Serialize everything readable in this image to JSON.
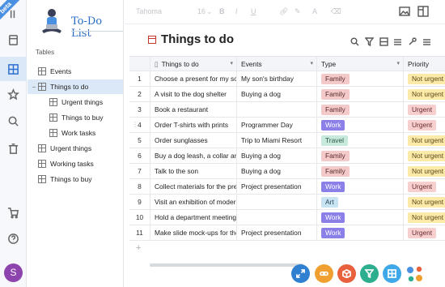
{
  "badge": "beta",
  "app": {
    "title": "To-Do List"
  },
  "sidebar": {
    "section_label": "Tables",
    "items": [
      {
        "label": "Events",
        "toggle": ""
      },
      {
        "label": "Things to do",
        "toggle": "−"
      },
      {
        "label": "Urgent things",
        "toggle": ""
      },
      {
        "label": "Things to buy",
        "toggle": ""
      },
      {
        "label": "Work tasks",
        "toggle": ""
      },
      {
        "label": "Urgent things",
        "toggle": ""
      },
      {
        "label": "Working tasks",
        "toggle": ""
      },
      {
        "label": "Things to buy",
        "toggle": ""
      }
    ]
  },
  "user": {
    "initial": "S"
  },
  "toolbar": {
    "font": "Tahoma",
    "size": "16",
    "bold": "B",
    "italic": "I",
    "underline": "U"
  },
  "view": {
    "title": "Things to do"
  },
  "columns": [
    "Things to do",
    "Events",
    "Type",
    "Priority"
  ],
  "rows": [
    {
      "num": "1",
      "task": "Choose a present for my son",
      "event": "My son's birthday",
      "type": "Family",
      "priority": "Not urgent"
    },
    {
      "num": "2",
      "task": "A visit to the dog shelter",
      "event": "Buying a dog",
      "type": "Family",
      "priority": "Not urgent"
    },
    {
      "num": "3",
      "task": "Book a restaurant",
      "event": "",
      "type": "Family",
      "priority": "Urgent"
    },
    {
      "num": "4",
      "task": "Order T-shirts with prints",
      "event": "Programmer Day",
      "type": "Work",
      "priority": "Urgent"
    },
    {
      "num": "5",
      "task": "Order sunglasses",
      "event": "Trip to Miami Resort",
      "type": "Travel",
      "priority": "Not urgent"
    },
    {
      "num": "6",
      "task": "Buy a dog leash, a collar and",
      "event": "Buying a dog",
      "type": "Family",
      "priority": "Not urgent"
    },
    {
      "num": "7",
      "task": "Talk to the son",
      "event": "Buying a dog",
      "type": "Family",
      "priority": "Not urgent"
    },
    {
      "num": "8",
      "task": "Collect materials for the pres",
      "event": "Project presentation",
      "type": "Work",
      "priority": "Urgent"
    },
    {
      "num": "9",
      "task": "Visit an exhibition of modern",
      "event": "",
      "type": "Art",
      "priority": "Not urgent"
    },
    {
      "num": "10",
      "task": "Hold a department meeting",
      "event": "",
      "type": "Work",
      "priority": "Not urgent"
    },
    {
      "num": "11",
      "task": "Make slide mock-ups for the",
      "event": "Project presentation",
      "type": "Work",
      "priority": "Urgent"
    }
  ],
  "add_row": "+",
  "tag_colors": {
    "Family": {
      "bg": "#f4c9c9",
      "fg": "#5a2a2a"
    },
    "Work": {
      "bg": "#8b80e8",
      "fg": "#ffffff"
    },
    "Travel": {
      "bg": "#c8eadc",
      "fg": "#2c5a48"
    },
    "Art": {
      "bg": "#c8e3f2",
      "fg": "#2a4a5c"
    },
    "Urgent": {
      "bg": "#f7cfcf",
      "fg": "#6a2a2a"
    },
    "Not urgent": {
      "bg": "#fbeaa8",
      "fg": "#5a4a1a"
    }
  },
  "fab_colors": [
    "#2f80d0",
    "#f0a030",
    "#e8603c",
    "#2dae8e",
    "#3fa8e8"
  ],
  "accent": "#2f6fd0"
}
